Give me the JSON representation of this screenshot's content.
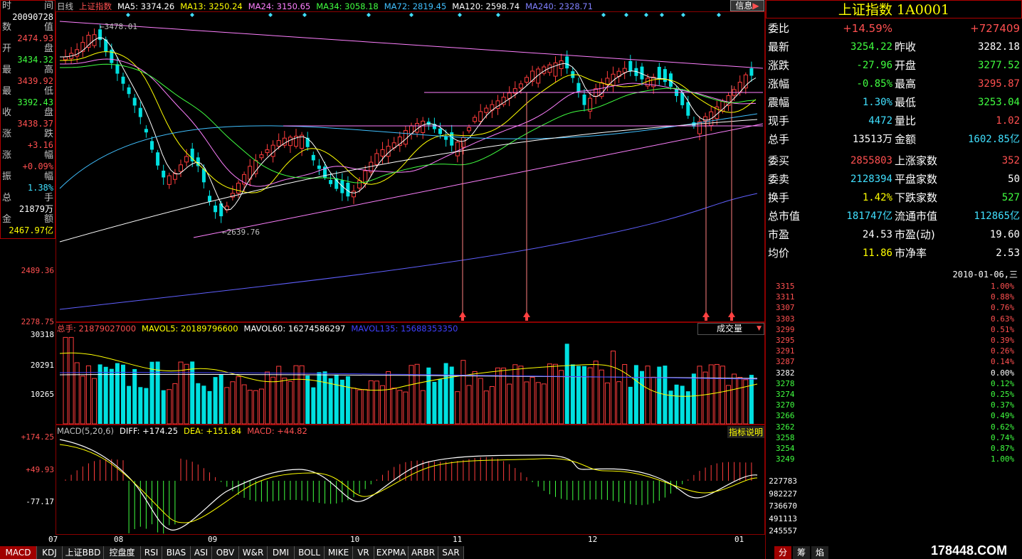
{
  "window": {
    "watermark": "178448.COM"
  },
  "kline": {
    "legend": [
      {
        "label": "日线",
        "color": "#c0c0c0"
      },
      {
        "label": "上证指数",
        "color": "#ff5050"
      },
      {
        "label": "MA5: 3374.26",
        "color": "#ffffff"
      },
      {
        "label": "MA13: 3250.24",
        "color": "#ffff00"
      },
      {
        "label": "MA24: 3150.65",
        "color": "#ff80ff"
      },
      {
        "label": "MA34: 3058.18",
        "color": "#40ff40"
      },
      {
        "label": "MA72: 2819.45",
        "color": "#40c0ff"
      },
      {
        "label": "MA120: 2598.74",
        "color": "#ffffff"
      },
      {
        "label": "MA240: 2328.71",
        "color": "#8080ff"
      }
    ],
    "info_button": "信息",
    "high_label": "3478.01",
    "low_label": "2639.76",
    "left_axis": [
      "2489.36",
      "2278.75"
    ],
    "month_labels": [
      "07",
      "08",
      "09",
      "10",
      "11",
      "12",
      "01"
    ]
  },
  "infobox": {
    "rows": [
      {
        "l": "时",
        "r": "间",
        "v": "",
        "vc": "#ffffff"
      },
      {
        "l": "",
        "r": "",
        "v": "20090728",
        "vc": "#ffffff"
      },
      {
        "l": "数",
        "r": "值",
        "v": "",
        "vc": "#ffffff"
      },
      {
        "l": "",
        "r": "",
        "v": "2474.93",
        "vc": "#ff5050"
      },
      {
        "l": "开",
        "r": "盘",
        "v": "",
        "vc": "#ffffff"
      },
      {
        "l": "",
        "r": "",
        "v": "3434.32",
        "vc": "#40ff40"
      },
      {
        "l": "最",
        "r": "高",
        "v": "",
        "vc": "#ffffff"
      },
      {
        "l": "",
        "r": "",
        "v": "3439.92",
        "vc": "#ff5050"
      },
      {
        "l": "最",
        "r": "低",
        "v": "",
        "vc": "#ffffff"
      },
      {
        "l": "",
        "r": "",
        "v": "3392.43",
        "vc": "#40ff40"
      },
      {
        "l": "收",
        "r": "盘",
        "v": "",
        "vc": "#ffffff"
      },
      {
        "l": "",
        "r": "",
        "v": "3438.37",
        "vc": "#ff5050"
      },
      {
        "l": "涨",
        "r": "跌",
        "v": "",
        "vc": "#ffffff"
      },
      {
        "l": "",
        "r": "",
        "v": "+3.16",
        "vc": "#ff5050"
      },
      {
        "l": "涨",
        "r": "幅",
        "v": "",
        "vc": "#ffffff"
      },
      {
        "l": "",
        "r": "",
        "v": "+0.09%",
        "vc": "#ff5050"
      },
      {
        "l": "振",
        "r": "幅",
        "v": "",
        "vc": "#ffffff"
      },
      {
        "l": "",
        "r": "",
        "v": "1.38%",
        "vc": "#40e0ff"
      },
      {
        "l": "总",
        "r": "手",
        "v": "",
        "vc": "#ffffff"
      },
      {
        "l": "",
        "r": "",
        "v": "21879万",
        "vc": "#ffffff"
      },
      {
        "l": "金",
        "r": "额",
        "v": "",
        "vc": "#ffffff"
      },
      {
        "l": "",
        "r": "",
        "v": "2467.97亿",
        "vc": "#ffff00"
      }
    ]
  },
  "volume": {
    "legend": [
      {
        "label": "总手: 21879027000",
        "color": "#ff5050"
      },
      {
        "label": "MAVOL5: 20189796600",
        "color": "#ffff00"
      },
      {
        "label": "MAVOL60: 16274586297",
        "color": "#ffffff"
      },
      {
        "label": "MAVOL135: 15688353350",
        "color": "#4040ff"
      }
    ],
    "dropdown": "成交量",
    "axis": [
      "30318",
      "20291",
      "10265"
    ]
  },
  "macd": {
    "legend": [
      {
        "label": "MACD(5,20,6)",
        "color": "#c0c0c0"
      },
      {
        "label": "DIFF: +174.25",
        "color": "#ffffff"
      },
      {
        "label": "DEA: +151.84",
        "color": "#ffff00"
      },
      {
        "label": "MACD: +44.82",
        "color": "#ff5050"
      }
    ],
    "help_button": "指标说明",
    "axis": [
      "+174.25",
      "+49.93",
      "-77.17"
    ]
  },
  "tabs": [
    "MACD",
    "KDJ",
    "上证BBD",
    "控盘度",
    "RSI",
    "BIAS",
    "ASI",
    "OBV",
    "W&R",
    "DMI",
    "BOLL",
    "MIKE",
    "VR",
    "EXPMA",
    "ARBR",
    "SAR"
  ],
  "quote": {
    "title": "上证指数 1A0001",
    "weibi": {
      "label": "委比",
      "pct": "+14.59%",
      "val": "+727409"
    },
    "rows": [
      {
        "l1": "最新",
        "v1": "3254.22",
        "c1": "#40ff40",
        "l2": "昨收",
        "v2": "3282.18",
        "c2": "#ffffff"
      },
      {
        "l1": "涨跌",
        "v1": "-27.96",
        "c1": "#40ff40",
        "l2": "开盘",
        "v2": "3277.52",
        "c2": "#40ff40"
      },
      {
        "l1": "涨幅",
        "v1": "-0.85%",
        "c1": "#40ff40",
        "l2": "最高",
        "v2": "3295.87",
        "c2": "#ff5050"
      },
      {
        "l1": "震幅",
        "v1": "1.30%",
        "c1": "#40e0ff",
        "l2": "最低",
        "v2": "3253.04",
        "c2": "#40ff40"
      },
      {
        "l1": "现手",
        "v1": "4472",
        "c1": "#40e0ff",
        "l2": "量比",
        "v2": "1.02",
        "c2": "#ff5050"
      },
      {
        "l1": "总手",
        "v1": "13513万",
        "c1": "#ffffff",
        "l2": "金额",
        "v2": "1602.85亿",
        "c2": "#40e0ff"
      },
      {
        "l1": "委买",
        "v1": "2855803",
        "c1": "#ff5050",
        "l2": "上涨家数",
        "v2": "352",
        "c2": "#ff5050"
      },
      {
        "l1": "委卖",
        "v1": "2128394",
        "c1": "#40e0ff",
        "l2": "平盘家数",
        "v2": "50",
        "c2": "#ffffff"
      },
      {
        "l1": "换手",
        "v1": "1.42%",
        "c1": "#ffff00",
        "l2": "下跌家数",
        "v2": "527",
        "c2": "#40ff40"
      },
      {
        "l1": "总市值",
        "v1": "181747亿",
        "c1": "#40e0ff",
        "l2": "流通市值",
        "v2": "112865亿",
        "c2": "#40e0ff"
      },
      {
        "l1": "市盈",
        "v1": "24.53",
        "c1": "#ffffff",
        "l2": "市盈(动)",
        "v2": "19.60",
        "c2": "#ffffff"
      },
      {
        "l1": "均价",
        "v1": "11.86",
        "c1": "#ffff00",
        "l2": "市净率",
        "v2": "2.53",
        "c2": "#ffffff"
      }
    ]
  },
  "intraday": {
    "date": "2010-01-06,三",
    "price_axis": [
      "3315",
      "3311",
      "3307",
      "3303",
      "3299",
      "3295",
      "3291",
      "3287",
      "3282",
      "3278",
      "3274",
      "3270",
      "3266",
      "3262",
      "3258",
      "3254",
      "3249"
    ],
    "pct_axis": [
      "1.00%",
      "0.88%",
      "0.76%",
      "0.63%",
      "0.51%",
      "0.39%",
      "0.26%",
      "0.14%",
      "0.00%",
      "0.12%",
      "0.25%",
      "0.37%",
      "0.49%",
      "0.62%",
      "0.74%",
      "0.87%",
      "1.00%"
    ],
    "vol_axis": [
      "227783",
      "982227",
      "736670",
      "491113",
      "245557"
    ],
    "bottom_tabs": [
      "分",
      "筹",
      "焰"
    ]
  },
  "colors": {
    "up": "#ff3c3c",
    "down": "#00e0e0",
    "grid": "#8b0000"
  }
}
